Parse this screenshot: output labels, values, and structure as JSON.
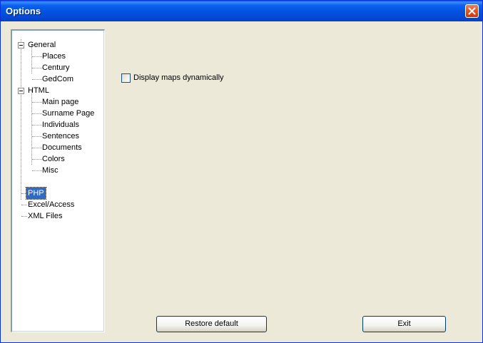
{
  "window": {
    "title": "Options"
  },
  "tree": {
    "nodes": [
      {
        "label": "General"
      },
      {
        "label": "Places"
      },
      {
        "label": "Century"
      },
      {
        "label": "GedCom"
      },
      {
        "label": "HTML"
      },
      {
        "label": "Main page"
      },
      {
        "label": "Surname Page"
      },
      {
        "label": "Individuals"
      },
      {
        "label": "Sentences"
      },
      {
        "label": "Documents"
      },
      {
        "label": "Colors"
      },
      {
        "label": "Misc"
      },
      {
        "label": "PHP",
        "selected": true
      },
      {
        "label": "Excel/Access"
      },
      {
        "label": "XML Files"
      }
    ]
  },
  "php_panel": {
    "display_maps_label": "Display maps dynamically",
    "display_maps_checked": false
  },
  "buttons": {
    "restore_label": "Restore default",
    "exit_label": "Exit"
  },
  "colors": {
    "titlebar": "#0553E0",
    "selection": "#316AC5",
    "dialog_bg": "#ECE9D8"
  }
}
